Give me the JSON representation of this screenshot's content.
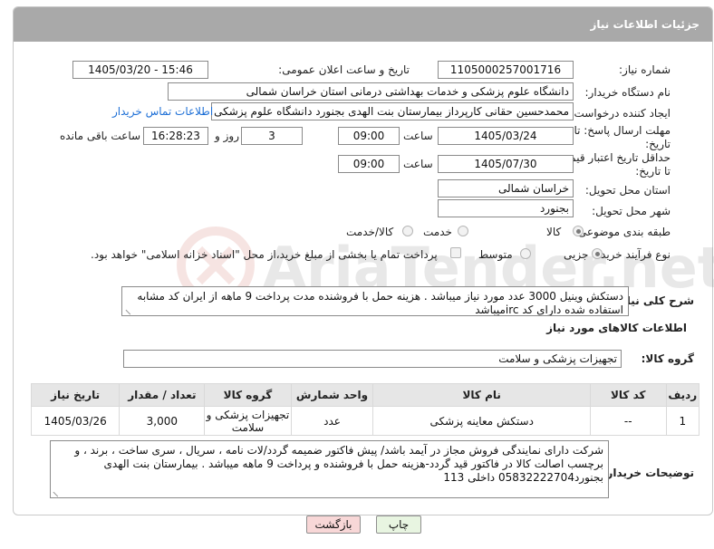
{
  "header": {
    "title": "جزئیات اطلاعات نیاز"
  },
  "watermark": {
    "text": "AriaTender.net"
  },
  "fields": {
    "need_number_label": "شماره نیاز:",
    "need_number": "1105000257001716",
    "announce_label": "تاریخ و ساعت اعلان عمومی:",
    "announce_value": "1405/03/20 - 15:46",
    "buyer_org_label": "نام دستگاه خریدار:",
    "buyer_org": "دانشگاه علوم پزشکی و خدمات بهداشتی درمانی استان خراسان شمالی",
    "creator_label": "ایجاد کننده درخواست:",
    "creator": "محمدحسین حقانی کارپرداز بیمارستان بنت الهدی بجنورد دانشگاه علوم پزشکی",
    "contact_link": "اطلاعات تماس خریدار",
    "deadline_label_1": "مهلت ارسال پاسخ: تا",
    "deadline_label_2": "تاریخ:",
    "deadline_date": "1405/03/24",
    "time_label": "ساعت",
    "deadline_time": "09:00",
    "days_value": "3",
    "days_label": "روز و",
    "remaining_time": "16:28:23",
    "remaining_label": "ساعت باقی مانده",
    "validity_label_1": "حداقل تاریخ اعتبار قیمت:",
    "validity_label_2": "تا تاریخ:",
    "validity_date": "1405/07/30",
    "validity_time_label": "ساعت",
    "validity_time": "09:00",
    "province_label": "استان محل تحویل:",
    "province": "خراسان شمالی",
    "city_label": "شهر محل تحویل:",
    "city": "بجنورد",
    "category_label": "طبقه بندی موضوعی:",
    "category_options": [
      "کالا",
      "خدمت",
      "کالا/خدمت"
    ],
    "category_selected": "کالا",
    "process_label": "نوع فرآیند خرید :",
    "process_options": [
      "جزیی",
      "متوسط"
    ],
    "process_selected": "جزیی",
    "payment_note": "پرداخت تمام یا بخشی از مبلغ خرید،از محل \"اسناد خزانه اسلامی\" خواهد بود."
  },
  "description": {
    "label": "شرح کلی نیاز:",
    "text": "دستکش وینیل 3000 عدد مورد نیاز میباشد . هزینه حمل با فروشنده مدت پرداخت 9 ماهه از ایران کد مشابه استفاده شده دارای کد ircمیباشد"
  },
  "goods": {
    "section_title": "اطلاعات کالاهای مورد نیاز",
    "group_label": "گروه کالا:",
    "group_value": "تجهیزات پزشکی و سلامت",
    "columns": [
      "ردیف",
      "کد کالا",
      "نام کالا",
      "واحد شمارش",
      "گروه کالا",
      "تعداد / مقدار",
      "تاریخ نیاز"
    ],
    "rows": [
      [
        "1",
        "--",
        "دستکش معاینه پزشکی",
        "عدد",
        "تجهیزات پزشکی و سلامت",
        "3,000",
        "1405/03/26"
      ]
    ]
  },
  "buyer_notes": {
    "label": "توضیحات خریدار:",
    "text": "شرکت دارای نمایندگی فروش مجاز در آیمد باشد/ پیش فاکتور ضمیمه گردد/لات نامه ، سریال ، سری ساخت ، برند ، و برچسب اصالت کالا در فاکتور قید گردد-هزینه حمل با فروشنده و پرداخت 9 ماهه میباشد . بیمارستان بنت الهدی بجنورد05832222704 داخلی 113"
  },
  "buttons": {
    "print": "چاپ",
    "back": "بازگشت"
  },
  "colors": {
    "header_bg": "#a9a9a9",
    "link": "#1d6fd6",
    "back_btn": "#f8d7d7",
    "print_btn": "#e8f5e1"
  }
}
